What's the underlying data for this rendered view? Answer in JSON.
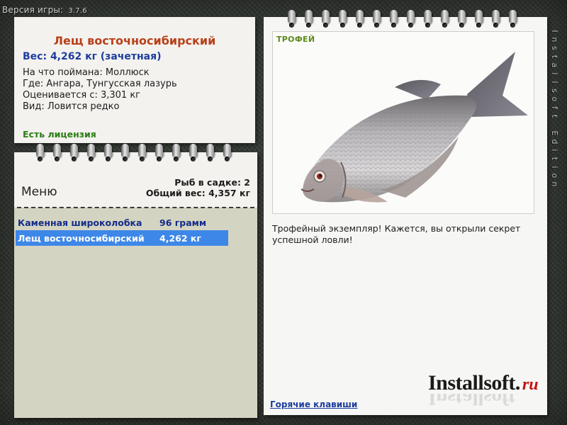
{
  "version": {
    "label": "Версия игры:",
    "number": "3.7.6"
  },
  "info": {
    "title": "Лещ восточносибирский",
    "weight": "Вес: 4,262 кг (зачетная)",
    "caught_on": "На что поймана: Моллюск",
    "location": "Где: Ангара, Тунгусская лазурь",
    "valued_from": "Оценивается с: 3,301 кг",
    "kind": "Вид: Ловится редко",
    "license": "Есть лицензия"
  },
  "menu": {
    "title": "Меню",
    "fish_in_cage": "Рыб в садке: 2",
    "total_weight": "Общий вес: 4,357 кг",
    "fish": [
      {
        "name": "Каменная широколобка",
        "weight": "96 грамм",
        "selected": false
      },
      {
        "name": "Лещ восточносибирский",
        "weight": "4,262 кг",
        "selected": true
      }
    ]
  },
  "trophy": {
    "label": "ТРОФЕЙ",
    "description": "Трофейный экземпляр! Кажется, вы открыли секрет успешной ловли!",
    "hotkeys": "Горячие клавиши",
    "brand_main": "Installsoft.",
    "brand_suffix": "ru"
  },
  "edition": "Installsoft Edition",
  "colors": {
    "title": "#b8401a",
    "weight": "#1d3d9e",
    "license": "#2b7d16",
    "selected": "#3d87e8",
    "trophy_label": "#5c8a1a",
    "brand_suffix": "#c21414"
  }
}
